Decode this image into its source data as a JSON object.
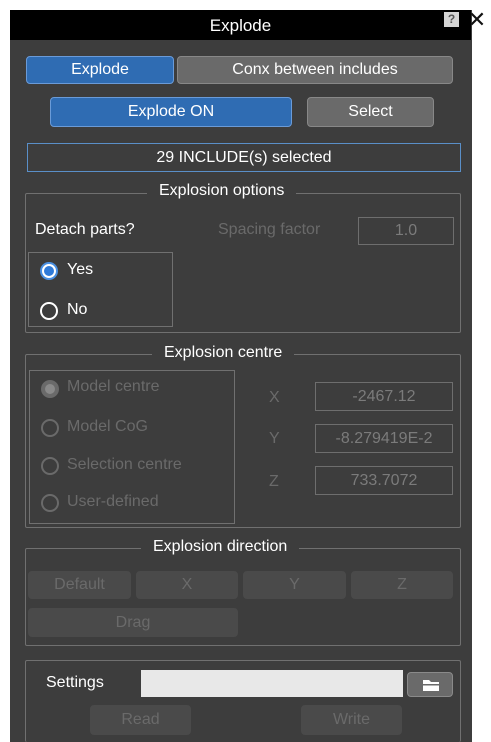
{
  "window": {
    "title": "Explode",
    "help_label": "?",
    "close_label": "✕"
  },
  "mode_tabs": [
    {
      "label": "Explode",
      "active": true
    },
    {
      "label": "Conx between includes",
      "active": false
    }
  ],
  "actions": {
    "explode_on_label": "Explode ON",
    "select_label": "Select"
  },
  "status": {
    "text": "29 INCLUDE(s) selected"
  },
  "explosion_options": {
    "title": "Explosion options",
    "detach_label": "Detach parts?",
    "spacing_label": "Spacing factor",
    "spacing_value": "1.0",
    "detach_options": [
      {
        "label": "Yes",
        "selected": true
      },
      {
        "label": "No",
        "selected": false
      }
    ]
  },
  "explosion_centre": {
    "title": "Explosion centre",
    "options": [
      {
        "label": "Model centre",
        "selected": true
      },
      {
        "label": "Model CoG",
        "selected": false
      },
      {
        "label": "Selection centre",
        "selected": false
      },
      {
        "label": "User-defined",
        "selected": false
      }
    ],
    "coords": [
      {
        "axis": "X",
        "value": "-2467.12"
      },
      {
        "axis": "Y",
        "value": "-8.279419E-2"
      },
      {
        "axis": "Z",
        "value": "733.7072"
      }
    ]
  },
  "explosion_direction": {
    "title": "Explosion direction",
    "buttons": [
      "Default",
      "X",
      "Y",
      "Z"
    ],
    "drag_label": "Drag"
  },
  "settings": {
    "label": "Settings",
    "value": "",
    "folder_icon": "folder-icon",
    "read_label": "Read",
    "write_label": "Write"
  },
  "colors": {
    "accent": "#2f6cb3",
    "panel": "#3d3d3d",
    "titlebar": "#000000"
  }
}
